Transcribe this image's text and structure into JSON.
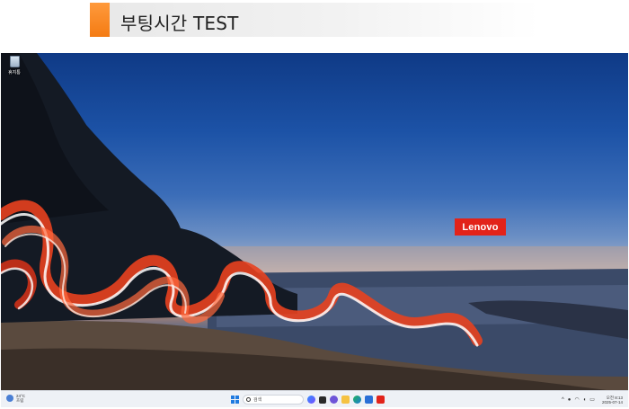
{
  "banner": {
    "title": "부팅시간 TEST",
    "accent_color": "#f47b13"
  },
  "desktop": {
    "icons": [
      {
        "label": "휴지통",
        "icon": "recycle-bin-icon"
      }
    ],
    "wallpaper": {
      "logo_text": "Lenovo",
      "logo_color": "#e2231a"
    }
  },
  "taskbar": {
    "weather": {
      "temp": "24°C",
      "condition": "흐림",
      "icon": "weather-cloud-icon"
    },
    "search": {
      "placeholder": "검색"
    },
    "pinned": [
      {
        "name": "start-icon"
      },
      {
        "name": "search-icon"
      },
      {
        "name": "copilot-icon"
      },
      {
        "name": "task-view-icon"
      },
      {
        "name": "chat-icon"
      },
      {
        "name": "file-explorer-icon"
      },
      {
        "name": "edge-browser-icon"
      },
      {
        "name": "microsoft-store-icon"
      },
      {
        "name": "lenovo-app-icon"
      }
    ],
    "tray": {
      "chevron": "^",
      "clock_time": "오전 8:13",
      "clock_date": "2025-07-14"
    }
  }
}
